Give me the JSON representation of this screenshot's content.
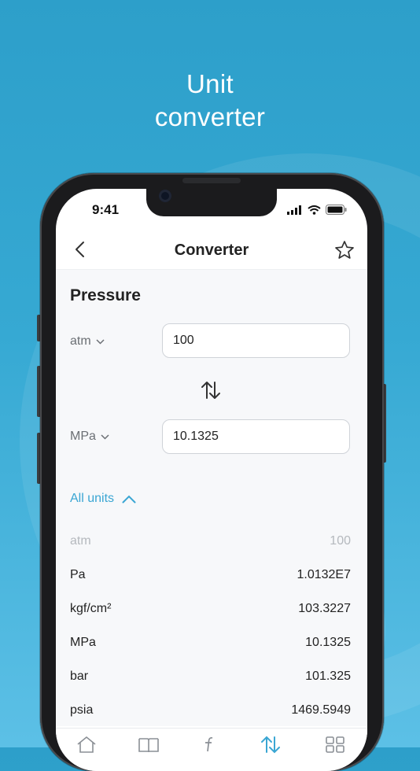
{
  "headline": {
    "line1": "Unit",
    "line2": "converter"
  },
  "status_bar": {
    "time": "9:41"
  },
  "nav": {
    "title": "Converter",
    "back_icon": "chevron-left-icon",
    "favorite_icon": "star-icon"
  },
  "converter": {
    "category": "Pressure",
    "from": {
      "unit": "atm",
      "value": "100"
    },
    "to": {
      "unit": "MPa",
      "value": "10.1325"
    },
    "swap_icon": "swap-arrows-icon"
  },
  "all_units": {
    "label": "All units",
    "rows": [
      {
        "unit": "atm",
        "value": "100"
      },
      {
        "unit": "Pa",
        "value": "1.0132E7"
      },
      {
        "unit": "kgf/cm²",
        "value": "103.3227"
      },
      {
        "unit": "MPa",
        "value": "10.1325"
      },
      {
        "unit": "bar",
        "value": "101.325"
      },
      {
        "unit": "psia",
        "value": "1469.5949"
      }
    ]
  },
  "tab_bar": {
    "tabs": [
      {
        "icon": "home-icon",
        "active": false
      },
      {
        "icon": "book-icon",
        "active": false
      },
      {
        "icon": "formula-icon",
        "active": false
      },
      {
        "icon": "converter-icon",
        "active": true
      },
      {
        "icon": "grid-icon",
        "active": false
      }
    ]
  },
  "colors": {
    "accent": "#3aa6d3",
    "background_top": "#2d9fca",
    "background_bottom": "#5cc0e6"
  }
}
